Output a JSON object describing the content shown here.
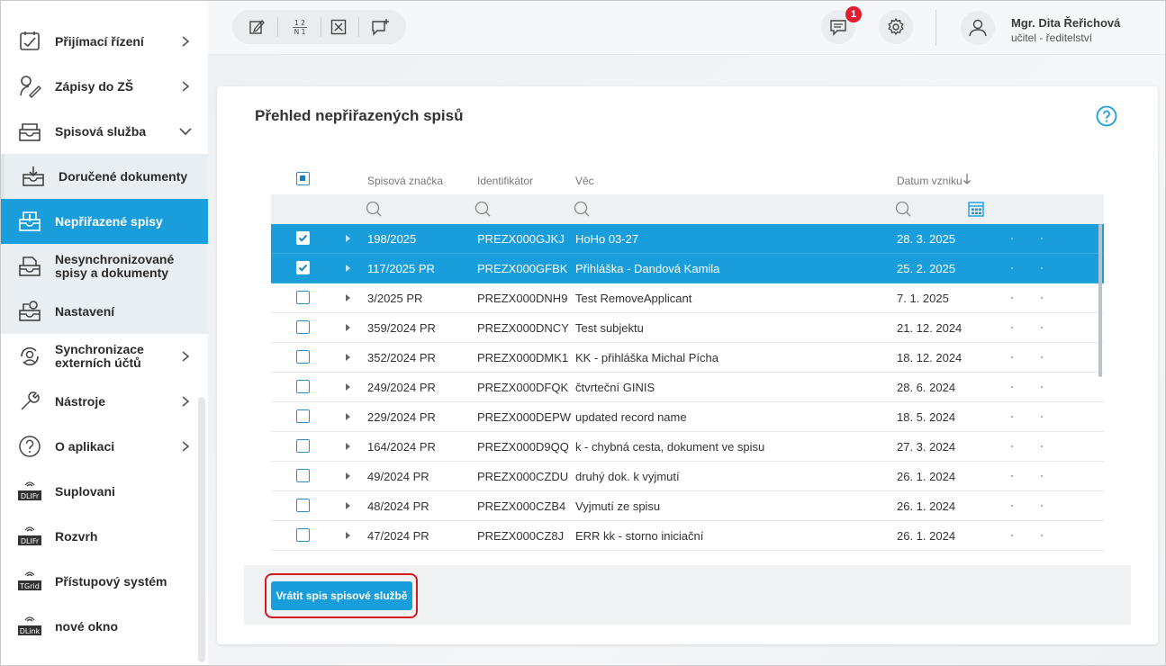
{
  "sidebar": {
    "items": [
      {
        "label": "Přijímací řízení",
        "icon": "admission-icon",
        "chevron": "right"
      },
      {
        "label": "Zápisy do ZŠ",
        "icon": "enrollment-icon",
        "chevron": "right"
      },
      {
        "label": "Spisová služba",
        "icon": "records-service-icon",
        "chevron": "down"
      },
      {
        "label": "Doručené dokumenty",
        "icon": "inbox-tray-icon"
      },
      {
        "label": "Nepřiřazené spisy",
        "icon": "unassigned-files-icon"
      },
      {
        "label_line1": "Nesynchronizované",
        "label_line2": "spisy a dokumenty",
        "icon": "unsynced-files-icon"
      },
      {
        "label": "Nastavení",
        "icon": "settings-tray-icon"
      },
      {
        "label_line1": "Synchronizace",
        "label_line2": "externích účtů",
        "icon": "sync-accounts-icon",
        "chevron": "right"
      },
      {
        "label": "Nástroje",
        "icon": "wrench-icon",
        "chevron": "right"
      },
      {
        "label": "O aplikaci",
        "icon": "question-icon",
        "chevron": "right"
      },
      {
        "label": "Suplovani",
        "icon": "dlifr-plugin-icon",
        "tag": "DLIFr"
      },
      {
        "label": "Rozvrh",
        "icon": "dlifr-plugin-icon",
        "tag": "DLIFr"
      },
      {
        "label": "Přístupový systém",
        "icon": "tgrid-plugin-icon",
        "tag": "TGrid"
      },
      {
        "label": "nové okno",
        "icon": "dlink-plugin-icon",
        "tag": "DLink"
      }
    ]
  },
  "topbar": {
    "tools": [
      "edit-icon",
      "numbering-icon",
      "close-box-icon",
      "add-comment-icon"
    ],
    "numbering_top": "1 2",
    "numbering_bottom": "N 1",
    "notification_count": "1",
    "user_name": "Mgr. Dita Řeřichová",
    "user_role": "učitel - ředitelství"
  },
  "panel": {
    "title": "Přehled nepřiřazených spisů",
    "columns": {
      "file_mark": "Spisová značka",
      "identifier": "Identifikátor",
      "subject": "Věc",
      "created": "Datum vzniku"
    },
    "rows": [
      {
        "mark": "198/2025",
        "id": "PREZX000GJKJ",
        "subject": "HoHo 03-27",
        "date": "28. 3. 2025",
        "selected": true
      },
      {
        "mark": "117/2025 PR",
        "id": "PREZX000GFBK",
        "subject": "Přihláška - Dandová Kamila",
        "date": "25. 2. 2025",
        "selected": true
      },
      {
        "mark": "3/2025 PR",
        "id": "PREZX000DNH9",
        "subject": "Test RemoveApplicant",
        "date": "7. 1. 2025",
        "selected": false
      },
      {
        "mark": "359/2024 PR",
        "id": "PREZX000DNCY",
        "subject": "Test subjektu",
        "date": "21. 12. 2024",
        "selected": false
      },
      {
        "mark": "352/2024 PR",
        "id": "PREZX000DMK1",
        "subject": "KK - přihláška Michal Pícha",
        "date": "18. 12. 2024",
        "selected": false
      },
      {
        "mark": "249/2024 PR",
        "id": "PREZX000DFQK",
        "subject": "čtvrteční GINIS",
        "date": "28. 6. 2024",
        "selected": false
      },
      {
        "mark": "229/2024 PR",
        "id": "PREZX000DEPW",
        "subject": "updated record name",
        "date": "18. 5. 2024",
        "selected": false
      },
      {
        "mark": "164/2024 PR",
        "id": "PREZX000D9QQ",
        "subject": "k - chybná cesta, dokument ve spisu",
        "date": "27. 3. 2024",
        "selected": false
      },
      {
        "mark": "49/2024 PR",
        "id": "PREZX000CZDU",
        "subject": "druhý dok. k vyjmutí",
        "date": "26. 1. 2024",
        "selected": false
      },
      {
        "mark": "48/2024 PR",
        "id": "PREZX000CZB4",
        "subject": "Vyjmutí ze spisu",
        "date": "26. 1. 2024",
        "selected": false
      },
      {
        "mark": "47/2024 PR",
        "id": "PREZX000CZ8J",
        "subject": "ERR kk - storno iniciační",
        "date": "26. 1. 2024",
        "selected": false
      }
    ],
    "action_button": "Vrátit spis spisové službě"
  },
  "colors": {
    "accent": "#1a9ddb",
    "highlight_outline": "#d71920",
    "badge": "#e11d2f"
  }
}
